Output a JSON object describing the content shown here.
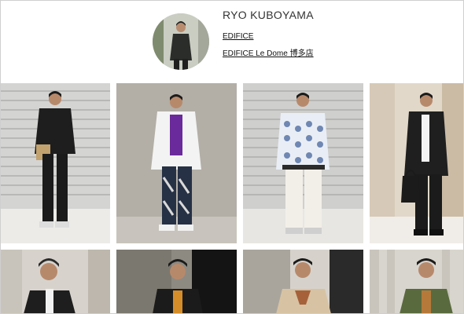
{
  "profile": {
    "name": "RYO KUBOYAMA",
    "links": [
      "EDIFICE",
      "EDIFICE Le Dome 博多店"
    ]
  },
  "colors": {
    "text": "#333333",
    "link": "#111111",
    "border": "#cfcfcf"
  },
  "grid": {
    "rows": 2,
    "columns": 4,
    "photos": [
      {
        "name": "outfit-photo-1"
      },
      {
        "name": "outfit-photo-2"
      },
      {
        "name": "outfit-photo-3"
      },
      {
        "name": "outfit-photo-4"
      },
      {
        "name": "outfit-photo-5"
      },
      {
        "name": "outfit-photo-6"
      },
      {
        "name": "outfit-photo-7"
      },
      {
        "name": "outfit-photo-8"
      }
    ]
  }
}
